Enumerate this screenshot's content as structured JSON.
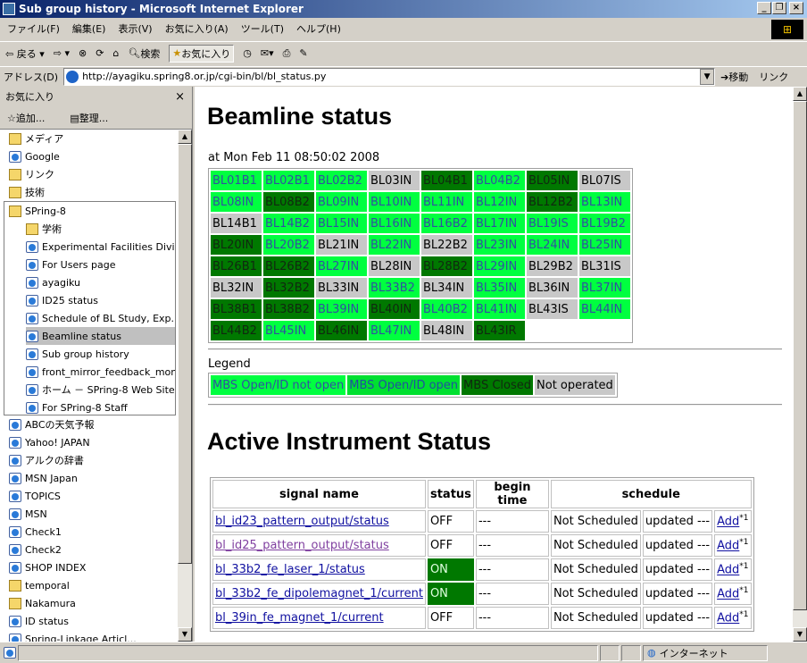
{
  "window": {
    "title": "Sub group history - Microsoft Internet Explorer",
    "min": "_",
    "max": "❐",
    "close": "×"
  },
  "menu": [
    "ファイル(F)",
    "編集(E)",
    "表示(V)",
    "お気に入り(A)",
    "ツール(T)",
    "ヘルプ(H)"
  ],
  "toolbar": {
    "back": "⇦ 戻る ▾",
    "forward": "⇨ ▾",
    "stop": "⊗",
    "refresh": "⟳",
    "home": "⌂",
    "search": "検索",
    "favorites": "お気に入り",
    "history": "◷",
    "mail": "✉▾",
    "print": "⎙",
    "edit": "✎"
  },
  "address": {
    "label": "アドレス(D)",
    "url": "http://ayagiku.spring8.or.jp/cgi-bin/bl/bl_status.py",
    "go": "移動",
    "links": "リンク"
  },
  "favorites": {
    "title": "お気に入り",
    "close": "×",
    "add": "追加...",
    "organize": "整理...",
    "items": [
      {
        "type": "folder",
        "label": "メディア"
      },
      {
        "type": "page",
        "label": "Google"
      },
      {
        "type": "folder",
        "label": "リンク"
      },
      {
        "type": "folder",
        "label": "技術"
      }
    ],
    "spring8": {
      "label": "SPring-8",
      "items": [
        {
          "type": "folder",
          "label": "学術"
        },
        {
          "type": "page",
          "label": "Experimental Facilities Divi..."
        },
        {
          "type": "page",
          "label": "For Users page"
        },
        {
          "type": "page",
          "label": "ayagiku"
        },
        {
          "type": "page",
          "label": "ID25 status"
        },
        {
          "type": "page",
          "label": "Schedule of BL Study, Exp..."
        },
        {
          "type": "page",
          "label": "Beamline status",
          "selected": true
        },
        {
          "type": "page",
          "label": "Sub group history"
        },
        {
          "type": "page",
          "label": "front_mirror_feedback_monit..."
        },
        {
          "type": "page",
          "label": "ホーム － SPring-8 Web Site"
        },
        {
          "type": "page",
          "label": "For SPring-8 Staff"
        }
      ]
    },
    "items2": [
      {
        "type": "page",
        "label": "ABCの天気予報"
      },
      {
        "type": "page",
        "label": "Yahoo! JAPAN"
      },
      {
        "type": "page",
        "label": "アルクの辞書"
      },
      {
        "type": "page",
        "label": "MSN Japan"
      },
      {
        "type": "page",
        "label": "TOPICS"
      },
      {
        "type": "page",
        "label": "MSN"
      },
      {
        "type": "page",
        "label": "Check1"
      },
      {
        "type": "page",
        "label": "Check2"
      },
      {
        "type": "page",
        "label": "SHOP INDEX"
      },
      {
        "type": "folder",
        "label": "temporal"
      },
      {
        "type": "folder",
        "label": "Nakamura"
      },
      {
        "type": "page",
        "label": "ID status"
      },
      {
        "type": "page",
        "label": "Spring-Linkage Articl..."
      }
    ]
  },
  "page": {
    "title": "Beamline status",
    "timestamp": "at Mon Feb 11 08:50:02 2008",
    "status_colors": {
      "og": "#00ff40",
      "dg": "#007800",
      "go": "#00e030",
      "no": "#c8c8c8"
    },
    "beamlines": [
      [
        [
          "BL01B1",
          "og"
        ],
        [
          "BL02B1",
          "og"
        ],
        [
          "BL02B2",
          "og"
        ],
        [
          "BL03IN",
          "no"
        ],
        [
          "BL04B1",
          "dg"
        ],
        [
          "BL04B2",
          "og"
        ],
        [
          "BL05IN",
          "dg"
        ],
        [
          "BL07IS",
          "no"
        ]
      ],
      [
        [
          "BL08IN",
          "og"
        ],
        [
          "BL08B2",
          "dg"
        ],
        [
          "BL09IN",
          "og"
        ],
        [
          "BL10IN",
          "og"
        ],
        [
          "BL11IN",
          "og"
        ],
        [
          "BL12IN",
          "og"
        ],
        [
          "BL12B2",
          "dg"
        ],
        [
          "BL13IN",
          "og"
        ]
      ],
      [
        [
          "BL14B1",
          "no"
        ],
        [
          "BL14B2",
          "og"
        ],
        [
          "BL15IN",
          "og"
        ],
        [
          "BL16IN",
          "og"
        ],
        [
          "BL16B2",
          "og"
        ],
        [
          "BL17IN",
          "og"
        ],
        [
          "BL19IS",
          "og"
        ],
        [
          "BL19B2",
          "og"
        ]
      ],
      [
        [
          "BL20IN",
          "dg"
        ],
        [
          "BL20B2",
          "og"
        ],
        [
          "BL21IN",
          "no"
        ],
        [
          "BL22IN",
          "og"
        ],
        [
          "BL22B2",
          "no"
        ],
        [
          "BL23IN",
          "og"
        ],
        [
          "BL24IN",
          "og"
        ],
        [
          "BL25IN",
          "og"
        ]
      ],
      [
        [
          "BL26B1",
          "dg"
        ],
        [
          "BL26B2",
          "dg"
        ],
        [
          "BL27IN",
          "og"
        ],
        [
          "BL28IN",
          "no"
        ],
        [
          "BL28B2",
          "dg"
        ],
        [
          "BL29IN",
          "og"
        ],
        [
          "BL29B2",
          "no"
        ],
        [
          "BL31IS",
          "no"
        ]
      ],
      [
        [
          "BL32IN",
          "no"
        ],
        [
          "BL32B2",
          "dg"
        ],
        [
          "BL33IN",
          "no"
        ],
        [
          "BL33B2",
          "og"
        ],
        [
          "BL34IN",
          "no"
        ],
        [
          "BL35IN",
          "og"
        ],
        [
          "BL36IN",
          "no"
        ],
        [
          "BL37IN",
          "og"
        ]
      ],
      [
        [
          "BL38B1",
          "dg"
        ],
        [
          "BL38B2",
          "dg"
        ],
        [
          "BL39IN",
          "og"
        ],
        [
          "BL40IN",
          "dg"
        ],
        [
          "BL40B2",
          "og"
        ],
        [
          "BL41IN",
          "og"
        ],
        [
          "BL43IS",
          "no"
        ],
        [
          "BL44IN",
          "og"
        ]
      ],
      [
        [
          "BL44B2",
          "dg"
        ],
        [
          "BL45IN",
          "og"
        ],
        [
          "BL46IN",
          "dg"
        ],
        [
          "BL47IN",
          "og"
        ],
        [
          "BL48IN",
          "no"
        ],
        [
          "BL43IR",
          "dg"
        ]
      ]
    ],
    "legend_title": "Legend",
    "legend": [
      [
        "MBS Open/ID not open",
        "og"
      ],
      [
        "MBS Open/ID open",
        "go"
      ],
      [
        "MBS Closed",
        "dg"
      ],
      [
        "Not operated",
        "no"
      ]
    ],
    "section2": "Active Instrument Status",
    "table_headers": [
      "signal name",
      "status",
      "begin time",
      "schedule"
    ],
    "rows": [
      {
        "signal": "bl_id23_pattern_output/status",
        "status": "OFF",
        "on": false,
        "begin": "---",
        "sched": "Not Scheduled",
        "updated": "updated ---",
        "add": "Add",
        "sup": "*1",
        "visited": false
      },
      {
        "signal": "bl_id25_pattern_output/status",
        "status": "OFF",
        "on": false,
        "begin": "---",
        "sched": "Not Scheduled",
        "updated": "updated ---",
        "add": "Add",
        "sup": "*1",
        "visited": true
      },
      {
        "signal": "bl_33b2_fe_laser_1/status",
        "status": "ON",
        "on": true,
        "begin": "---",
        "sched": "Not Scheduled",
        "updated": "updated ---",
        "add": "Add",
        "sup": "*1",
        "visited": false
      },
      {
        "signal": "bl_33b2_fe_dipolemagnet_1/current",
        "status": "ON",
        "on": true,
        "begin": "---",
        "sched": "Not Scheduled",
        "updated": "updated ---",
        "add": "Add",
        "sup": "*1",
        "visited": false
      },
      {
        "signal": "bl_39in_fe_magnet_1/current",
        "status": "OFF",
        "on": false,
        "begin": "---",
        "sched": "Not Scheduled",
        "updated": "updated ---",
        "add": "Add",
        "sup": "*1",
        "visited": false
      }
    ]
  },
  "statusbar": {
    "zone": "インターネット"
  }
}
